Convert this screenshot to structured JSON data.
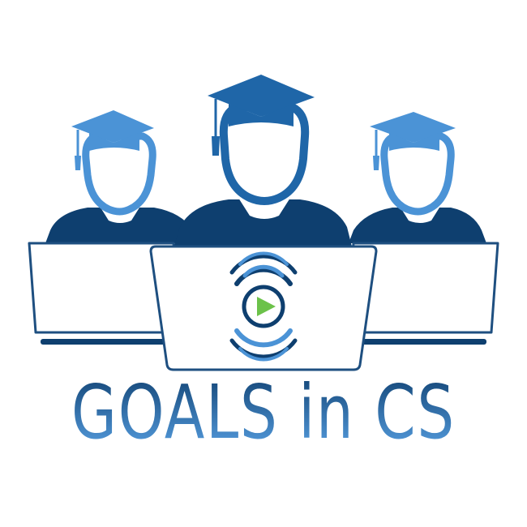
{
  "logo": {
    "wordmark": "GOALS in CS",
    "icons": [
      "graduate-icon",
      "laptop-icon",
      "play-icon",
      "broadcast-waves-icon"
    ],
    "colors": {
      "dark_navy": "#0e3f6f",
      "mid_blue": "#1f66a8",
      "light_blue": "#4b93d6",
      "text_light": "#5aa3e6",
      "play_green": "#6cc24a",
      "laptop_outline": "#1e4f80"
    }
  }
}
